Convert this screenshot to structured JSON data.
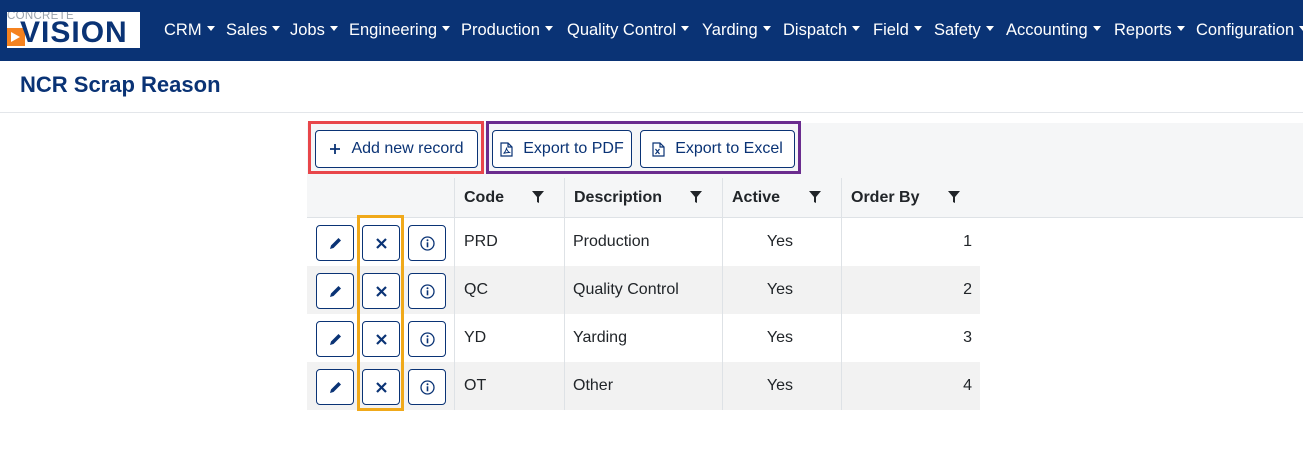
{
  "brand": {
    "logo_top": "CONCRETE",
    "logo_main": "VISION"
  },
  "nav": {
    "items": [
      {
        "label": "CRM"
      },
      {
        "label": "Sales"
      },
      {
        "label": "Jobs"
      },
      {
        "label": "Engineering"
      },
      {
        "label": "Production"
      },
      {
        "label": "Quality Control"
      },
      {
        "label": "Yarding"
      },
      {
        "label": "Dispatch"
      },
      {
        "label": "Field"
      },
      {
        "label": "Safety"
      },
      {
        "label": "Accounting"
      },
      {
        "label": "Reports"
      },
      {
        "label": "Configuration"
      }
    ]
  },
  "page": {
    "title": "NCR Scrap Reason"
  },
  "toolbar": {
    "add_label": "Add new record",
    "pdf_label": "Export to PDF",
    "excel_label": "Export to Excel"
  },
  "grid": {
    "columns": [
      {
        "label": "Code"
      },
      {
        "label": "Description"
      },
      {
        "label": "Active"
      },
      {
        "label": "Order By"
      }
    ],
    "rows": [
      {
        "code": "PRD",
        "description": "Production",
        "active": "Yes",
        "order_by": "1"
      },
      {
        "code": "QC",
        "description": "Quality Control",
        "active": "Yes",
        "order_by": "2"
      },
      {
        "code": "YD",
        "description": "Yarding",
        "active": "Yes",
        "order_by": "3"
      },
      {
        "code": "OT",
        "description": "Other",
        "active": "Yes",
        "order_by": "4"
      }
    ]
  },
  "colors": {
    "nav_background": "#0a3375",
    "accent": "#0a3375",
    "logo_orange": "#f5821f",
    "highlight_red": "#e8464a",
    "highlight_purple": "#6a2c8e",
    "highlight_orange": "#f0a91a"
  },
  "icons": {
    "edit": "pencil-icon",
    "delete": "close-icon",
    "details": "info-icon",
    "add": "plus-icon",
    "pdf": "pdf-file-icon",
    "excel": "excel-file-icon",
    "filter": "filter-icon"
  }
}
